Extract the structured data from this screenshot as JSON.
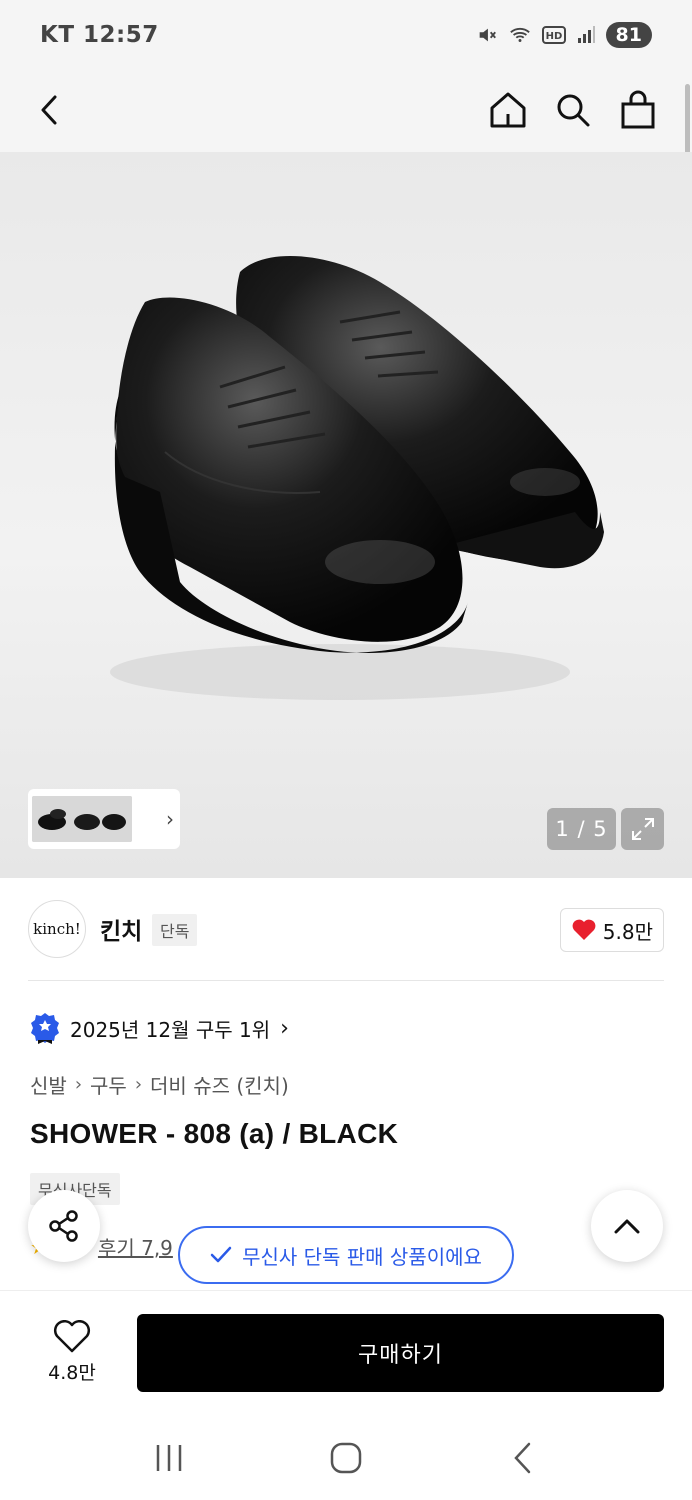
{
  "status_bar": {
    "carrier_time": "KT 12:57",
    "battery": "81"
  },
  "gallery": {
    "page_counter": "1 / 5"
  },
  "brand": {
    "logo_text": "kinch!",
    "name": "킨치",
    "badge": "단독",
    "like_count": "5.8만"
  },
  "ranking": {
    "text": "2025년 12월 구두 1위"
  },
  "breadcrumb": {
    "items": [
      "신발",
      "구두",
      "더비 슈즈 (킨치)"
    ]
  },
  "product": {
    "title": "SHOWER - 808 (a) / BLACK",
    "tag": "무신사단독"
  },
  "reviews": {
    "text": "후기 7,9"
  },
  "toast": {
    "text": "무신사 단독 판매 상품이에요"
  },
  "bottom_bar": {
    "like_count": "4.8만",
    "buy_label": "구매하기"
  },
  "colors": {
    "accent_blue": "#2a5ae8",
    "heart_red": "#e8202e",
    "buy_bg": "#000000"
  }
}
